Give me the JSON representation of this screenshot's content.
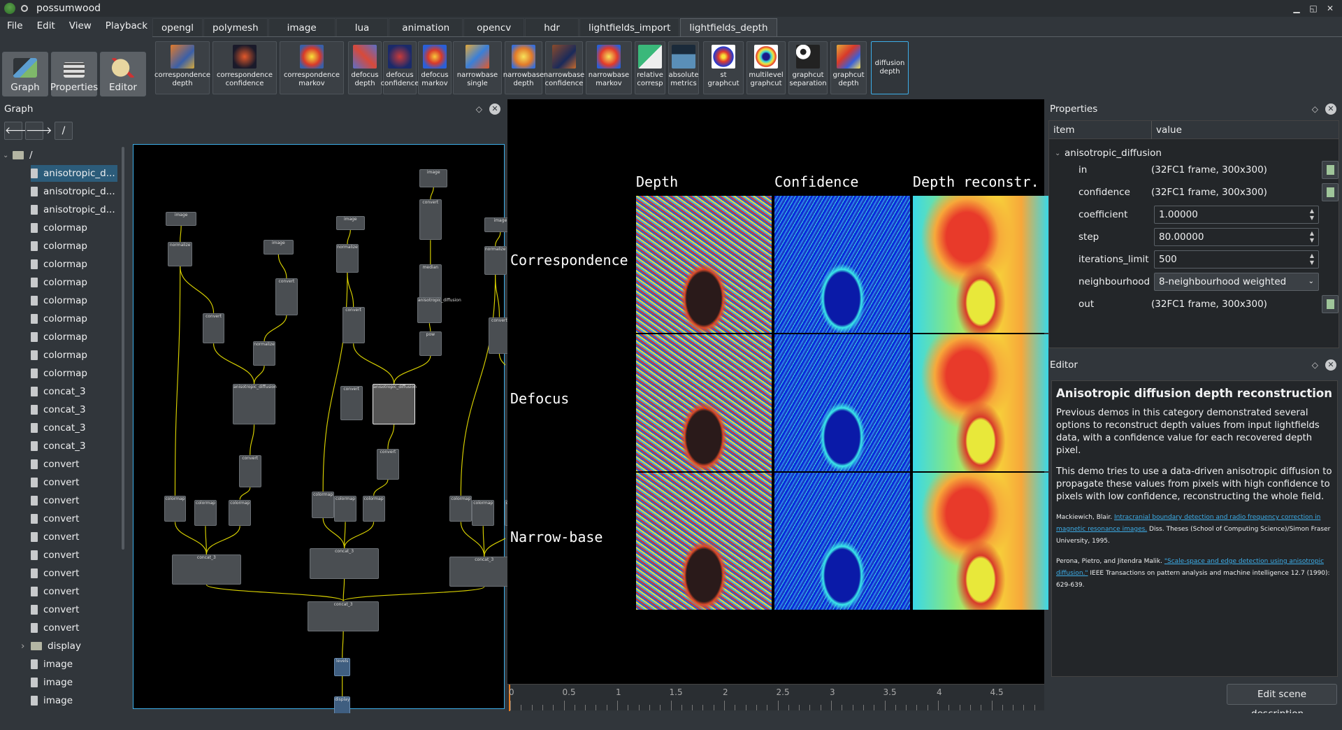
{
  "window": {
    "title": "possumwood"
  },
  "menu": [
    "File",
    "Edit",
    "View",
    "Playback"
  ],
  "modes": [
    {
      "label": "Graph",
      "icon": "graph-icon"
    },
    {
      "label": "Properties",
      "icon": "properties-icon"
    },
    {
      "label": "Editor",
      "icon": "editor-icon"
    }
  ],
  "tabs": [
    "opengl",
    "polymesh",
    "image",
    "lua",
    "animation",
    "opencv",
    "hdr",
    "lightfields_import",
    "lightfields_depth"
  ],
  "active_tab": "lightfields_depth",
  "toolbar": [
    {
      "l1": "correspondence",
      "l2": "depth"
    },
    {
      "l1": "correspondence",
      "l2": "confidence"
    },
    {
      "l1": "correspondence",
      "l2": "markov"
    },
    {
      "l1": "defocus",
      "l2": "depth"
    },
    {
      "l1": "defocus",
      "l2": "confidence"
    },
    {
      "l1": "defocus",
      "l2": "markov"
    },
    {
      "l1": "narrowbase",
      "l2": "single"
    },
    {
      "l1": "narrowbase",
      "l2": "depth"
    },
    {
      "l1": "narrowbase",
      "l2": "confidence"
    },
    {
      "l1": "narrowbase",
      "l2": "markov"
    },
    {
      "l1": "relative",
      "l2": "corresp"
    },
    {
      "l1": "absolute",
      "l2": "metrics"
    },
    {
      "l1": "st",
      "l2": "graphcut"
    },
    {
      "l1": "multilevel",
      "l2": "graphcut"
    },
    {
      "l1": "graphcut",
      "l2": "separation"
    },
    {
      "l1": "graphcut",
      "l2": "depth"
    },
    {
      "l1": "diffusion",
      "l2": "depth"
    }
  ],
  "graph": {
    "title": "Graph",
    "path": "/",
    "root": "/",
    "tree": [
      "anisotropic_d...",
      "anisotropic_d...",
      "anisotropic_d...",
      "colormap",
      "colormap",
      "colormap",
      "colormap",
      "colormap",
      "colormap",
      "colormap",
      "colormap",
      "colormap",
      "concat_3",
      "concat_3",
      "concat_3",
      "concat_3",
      "convert",
      "convert",
      "convert",
      "convert",
      "convert",
      "convert",
      "convert",
      "convert",
      "convert",
      "convert",
      "display",
      "image",
      "image",
      "image"
    ],
    "node_labels": {
      "image": "image",
      "normalize": "normalize",
      "convert": "convert",
      "median": "median",
      "anisotropic": "anisotropic_diffusion",
      "colormap": "colormap",
      "concat": "concat_3",
      "pow": "pow",
      "levels": "levels",
      "display": "display"
    }
  },
  "viewer": {
    "columns": [
      "Depth",
      "Confidence",
      "Depth reconstr."
    ],
    "rows": [
      "Correspondence",
      "Defocus",
      "Narrow-base"
    ],
    "timeline": [
      "0",
      "0.5",
      "1",
      "1.5",
      "2",
      "2.5",
      "3",
      "3.5",
      "4",
      "4.5"
    ]
  },
  "properties": {
    "title": "Properties",
    "col_item": "item",
    "col_value": "value",
    "node": "anisotropic_diffusion",
    "in_name": "in",
    "in_value": "(32FC1 frame, 300x300)",
    "confidence_name": "confidence",
    "confidence_value": "(32FC1 frame, 300x300)",
    "coefficient_name": "coefficient",
    "coefficient_value": "1.00000",
    "step_name": "step",
    "step_value": "80.00000",
    "iter_name": "iterations_limit",
    "iter_value": "500",
    "neigh_name": "neighbourhood",
    "neigh_value": "8-neighbourhood weighted",
    "out_name": "out",
    "out_value": "(32FC1 frame, 300x300)"
  },
  "editor": {
    "title": "Editor",
    "heading": "Anisotropic diffusion depth reconstruction",
    "p1": "Previous demos in this category demonstrated several options to reconstruct depth values from input lightfields data, with a confidence value for each recovered depth pixel.",
    "p2": "This demo tries to use a data-driven anisotropic diffusion to propagate these values from pixels with high confidence to pixels with low confidence, reconstructing the whole field.",
    "ref1_a": "Mackiewich, Blair.",
    "ref1_link": "Intracranial boundary detection and radio frequency correction in magnetic resonance images.",
    "ref1_b": "Diss. Theses (School of Computing Science)/Simon Fraser University, 1995.",
    "ref2_a": "Perona, Pietro, and Jitendra Malik.",
    "ref2_link": "\"Scale-space and edge detection using anisotropic diffusion.\"",
    "ref2_b": "IEEE Transactions on pattern analysis and machine intelligence 12.7 (1990): 629-639.",
    "edit_button": "Edit scene description..."
  }
}
